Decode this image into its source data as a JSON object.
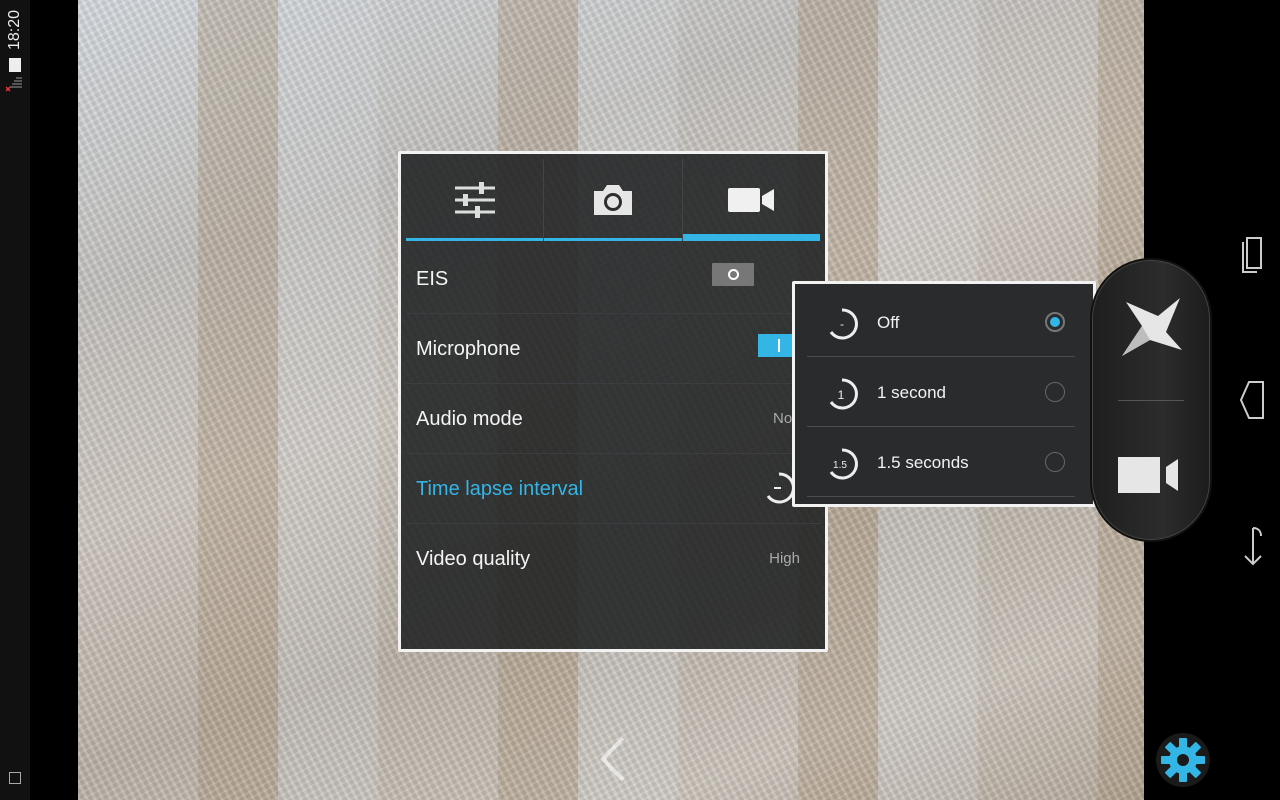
{
  "status_bar": {
    "time": "18:20"
  },
  "settings_panel": {
    "tabs": [
      {
        "icon": "sliders-icon",
        "active": false
      },
      {
        "icon": "camera-icon",
        "active": false
      },
      {
        "icon": "video-camera-icon",
        "active": true
      }
    ],
    "rows": [
      {
        "label": "EIS",
        "control": "toggle",
        "state": "off"
      },
      {
        "label": "Microphone",
        "control": "toggle",
        "state": "on"
      },
      {
        "label": "Audio mode",
        "value": "Norma"
      },
      {
        "label": "Time lapse interval",
        "control": "timelapse-icon",
        "highlighted": true
      },
      {
        "label": "Video quality",
        "value": "High"
      }
    ]
  },
  "time_lapse_popup": {
    "options": [
      {
        "label": "Off",
        "icon_text": "-",
        "selected": true
      },
      {
        "label": "1 second",
        "icon_text": "1",
        "selected": false
      },
      {
        "label": "1.5 seconds",
        "icon_text": "1.5",
        "selected": false
      }
    ]
  },
  "colors": {
    "accent": "#33b5e5",
    "panel_border": "#f2f2f2",
    "text": "#f4f4f4",
    "secondary_text": "#aaaaaa"
  }
}
